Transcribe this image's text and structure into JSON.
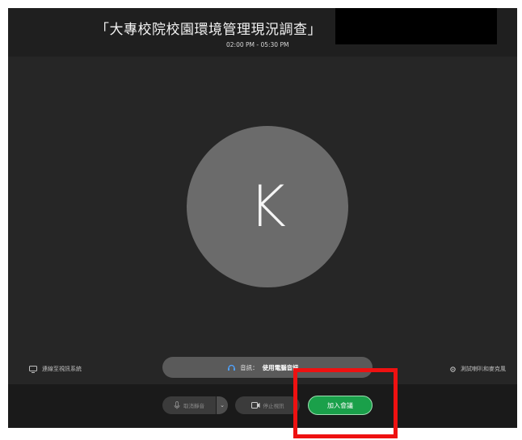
{
  "header": {
    "meeting_title": "「大專校院校園環境管理現況調查」",
    "meeting_time": "02:00 PM - 05:30 PM"
  },
  "participant": {
    "avatar_initial": "K"
  },
  "left_link": {
    "label": "連線至視訊系統",
    "icon": "cast-icon"
  },
  "audio": {
    "label": "音訊：",
    "value": "使用電腦音訊",
    "icon": "audio-icon",
    "chevron": "⌄"
  },
  "right_link": {
    "label": "測試喇叭和麥克風",
    "icon": "gear-icon"
  },
  "controls": {
    "mute_label": "取消靜音",
    "mute_dropdown": "⌄",
    "video_label": "停止視訊",
    "join_label": "加入會議"
  },
  "colors": {
    "join_green": "#1aa04a",
    "highlight_red": "#ee1111",
    "background": "#262626"
  }
}
